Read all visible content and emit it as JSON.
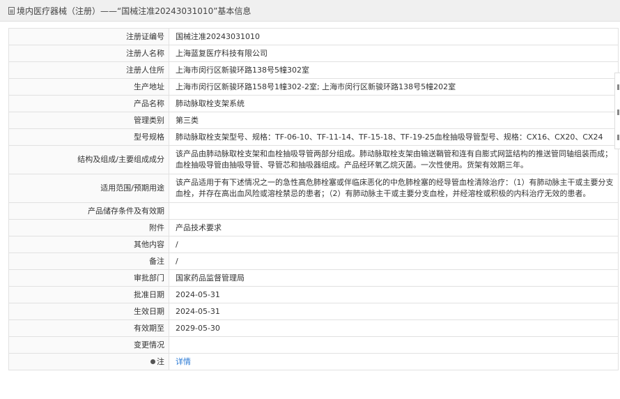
{
  "header": {
    "title": "境内医疗器械（注册）——“国械注准20243031010”基本信息"
  },
  "rows": [
    {
      "label": "注册证编号",
      "value": "国械注准20243031010"
    },
    {
      "label": "注册人名称",
      "value": "上海蓝复医疗科技有限公司"
    },
    {
      "label": "注册人住所",
      "value": "上海市闵行区新骏环路138号5幢302室"
    },
    {
      "label": "生产地址",
      "value": "上海市闵行区新骏环路158号1幢302-2室; 上海市闵行区新骏环路138号5幢202室"
    },
    {
      "label": "产品名称",
      "value": "肺动脉取栓支架系统"
    },
    {
      "label": "管理类别",
      "value": "第三类"
    },
    {
      "label": "型号规格",
      "value": "肺动脉取栓支架型号、规格：TF-06-10、TF-11-14、TF-15-18、TF-19-25血栓抽吸导管型号、规格：CX16、CX20、CX24"
    },
    {
      "label": "结构及组成/主要组成成分",
      "value": "该产品由肺动脉取栓支架和血栓抽吸导管两部分组成。肺动脉取栓支架由输送鞘管和连有自膨式网篮结构的推送管同轴组装而成；血栓抽吸导管由抽吸导管、导管芯和抽吸器组成。产品经环氧乙烷灭菌。一次性使用。货架有效期三年。"
    },
    {
      "label": "适用范围/预期用途",
      "value": "该产品适用于有下述情况之一的急性高危肺栓塞或伴临床恶化的中危肺栓塞的经导管血栓清除治疗：（1）有肺动脉主干或主要分支血栓，并存在高出血风险或溶栓禁忌的患者；（2）有肺动脉主干或主要分支血栓，并经溶栓或积极的内科治疗无效的患者。"
    },
    {
      "label": "产品储存条件及有效期",
      "value": ""
    },
    {
      "label": "附件",
      "value": "产品技术要求"
    },
    {
      "label": "其他内容",
      "value": "/"
    },
    {
      "label": "备注",
      "value": "/"
    },
    {
      "label": "审批部门",
      "value": "国家药品监督管理局"
    },
    {
      "label": "批准日期",
      "value": "2024-05-31"
    },
    {
      "label": "生效日期",
      "value": "2024-05-31"
    },
    {
      "label": "有效期至",
      "value": "2029-05-30"
    },
    {
      "label": "变更情况",
      "value": ""
    },
    {
      "label": "注",
      "value": "详情"
    }
  ]
}
